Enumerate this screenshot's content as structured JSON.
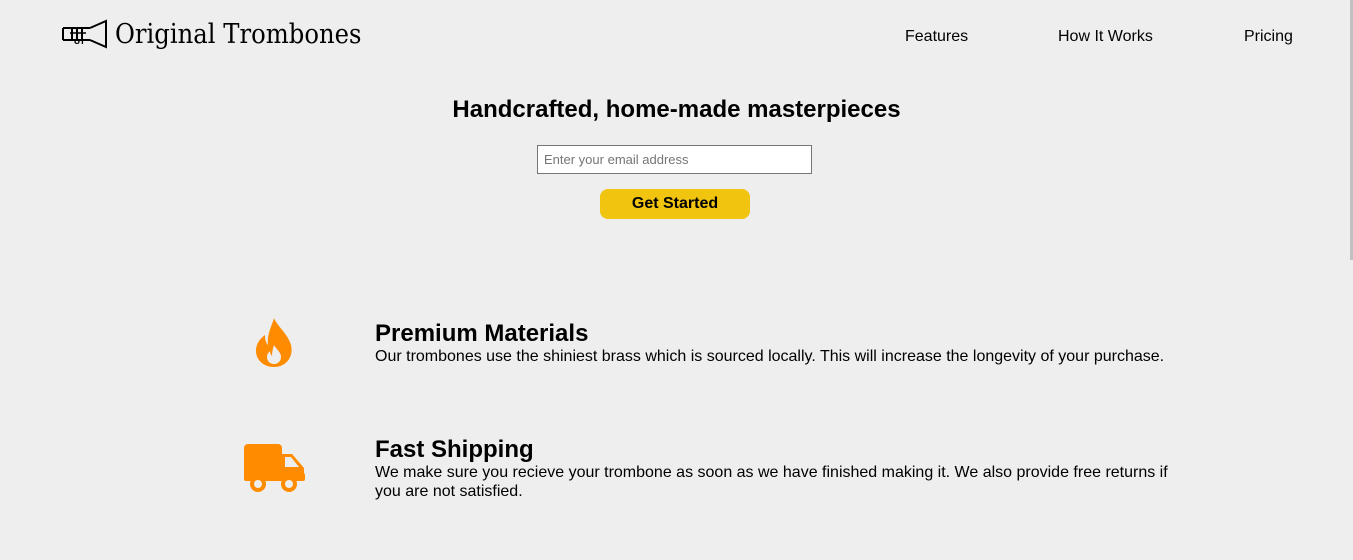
{
  "header": {
    "brand": "Original Trombones",
    "nav": [
      "Features",
      "How It Works",
      "Pricing"
    ]
  },
  "hero": {
    "title": "Handcrafted, home-made masterpieces",
    "email_placeholder": "Enter your email address",
    "cta_label": "Get Started",
    "cta_color": "#f1c40f"
  },
  "features": [
    {
      "icon": "fire-icon",
      "title": "Premium Materials",
      "description": "Our trombones use the shiniest brass which is sourced locally. This will increase the longevity of your purchase."
    },
    {
      "icon": "truck-icon",
      "title": "Fast Shipping",
      "description": "We make sure you recieve your trombone as soon as we have finished making it. We also provide free returns if you are not satisfied."
    }
  ],
  "colors": {
    "background": "#eeeeee",
    "icon_orange": "#ff8c00",
    "accent_yellow": "#f1c40f"
  }
}
